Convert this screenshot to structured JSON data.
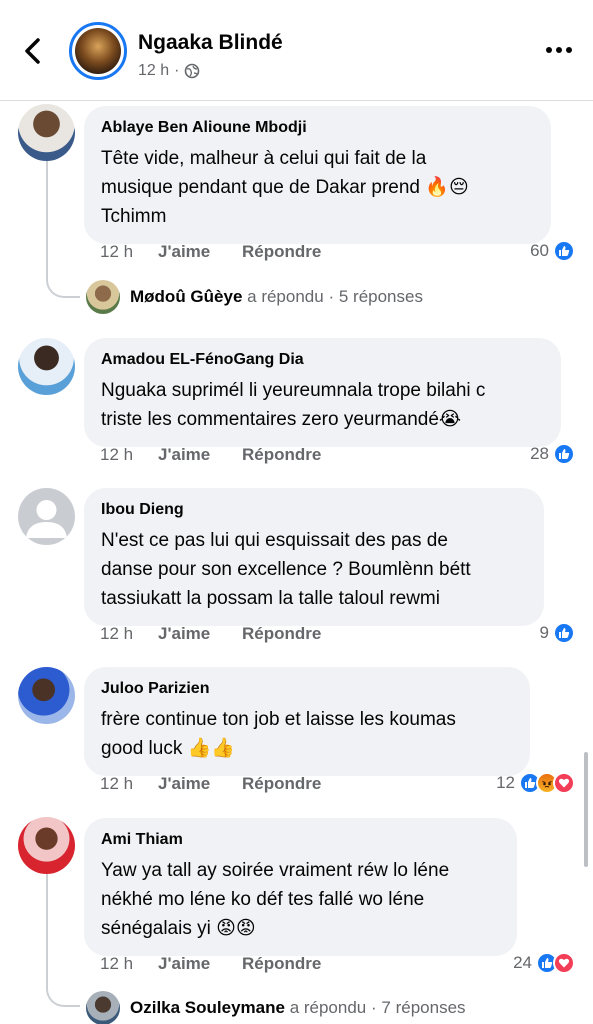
{
  "header": {
    "page_name": "Ngaaka Blindé",
    "time": "12 h",
    "sep": "·"
  },
  "icons": {
    "back": "chevron-left-icon",
    "more": "more-horizontal-icon",
    "globe": "globe-icon",
    "like": "like-reaction-icon",
    "angry": "angry-reaction-icon",
    "love": "love-reaction-icon"
  },
  "colors": {
    "accent": "#1877f2",
    "bubble": "#f0f2f5",
    "secondary_text": "#65676b"
  },
  "comments": [
    {
      "author": "Ablaye Ben Alioune Mbodji",
      "lines": [
        "Tête vide, malheur à celui qui fait de la",
        "musique pendant que de Dakar prend 🔥😔",
        "Tchimm"
      ],
      "time": "12 h",
      "like_label": "J'aime",
      "reply_label": "Répondre",
      "reaction_count": "60"
    },
    {
      "author": "Amadou EL-FénoGang Dia",
      "lines": [
        "Nguaka suprimél li yeureumnala trope bilahi c",
        "triste les commentaires zero yeurmandé😭"
      ],
      "time": "12 h",
      "like_label": "J'aime",
      "reply_label": "Répondre",
      "reaction_count": "28"
    },
    {
      "author": "Ibou Dieng",
      "lines": [
        "N'est ce pas lui qui esquissait des pas de",
        "danse pour son excellence ? Boumlènn bétt",
        "tassiukatt la possam la talle taloul rewmi"
      ],
      "time": "12 h",
      "like_label": "J'aime",
      "reply_label": "Répondre",
      "reaction_count": "9"
    },
    {
      "author": "Juloo Parizien",
      "lines": [
        "frère continue ton job et laisse les koumas",
        "good luck 👍👍"
      ],
      "time": "12 h",
      "like_label": "J'aime",
      "reply_label": "Répondre",
      "reaction_count": "12"
    },
    {
      "author": "Ami Thiam",
      "lines": [
        "Yaw ya tall ay soirée vraiment réw lo léne",
        "nékhé mo léne ko déf tes fallé wo léne",
        "sénégalais yi 😡😡"
      ],
      "time": "12 h",
      "like_label": "J'aime",
      "reply_label": "Répondre",
      "reaction_count": "24"
    }
  ],
  "replies": [
    {
      "name": "Mødoû Gûèye",
      "action": "a répondu",
      "sep": "·",
      "count": "5 réponses"
    },
    {
      "name": "Ozilka Souleymane",
      "action": "a répondu",
      "sep": "·",
      "count": "7 réponses"
    }
  ]
}
